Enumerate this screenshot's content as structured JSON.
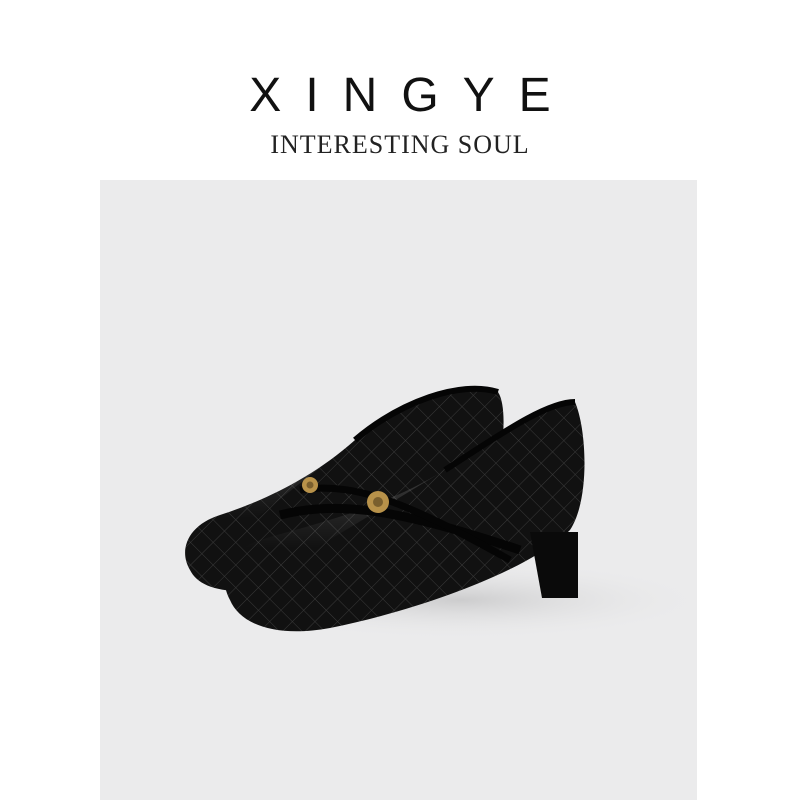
{
  "brand": {
    "name": "XINGYE",
    "tagline": "INTERESTING SOUL"
  },
  "photo": {
    "subject": "black-quilted-mary-jane-shoes",
    "colors": {
      "backdrop": "#ebebec",
      "leather": "#121212",
      "hardware": "#b8924a"
    }
  }
}
